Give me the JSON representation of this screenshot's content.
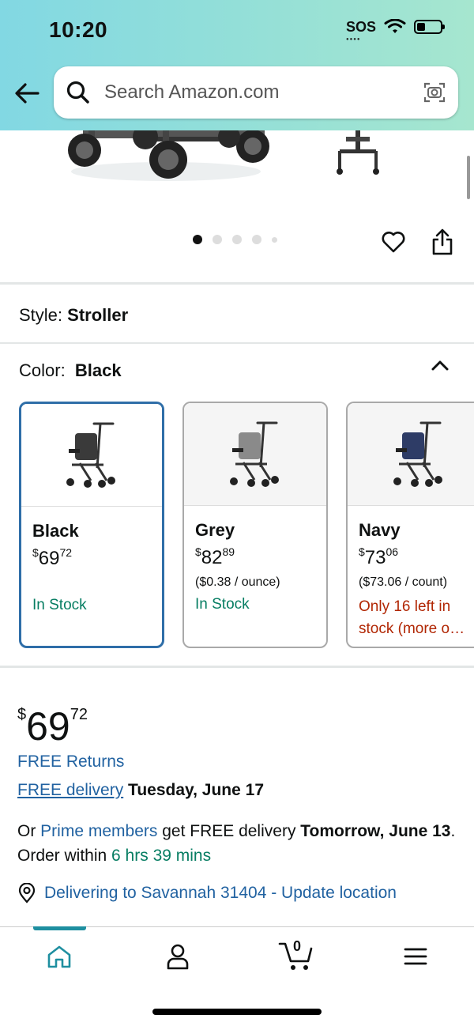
{
  "status_bar": {
    "time": "10:20",
    "sos": "SOS"
  },
  "search": {
    "placeholder": "Search Amazon.com"
  },
  "style": {
    "label": "Style:",
    "value": "Stroller"
  },
  "color": {
    "label": "Color:",
    "value": "Black"
  },
  "swatches": [
    {
      "name": "Black",
      "currency": "$",
      "whole": "69",
      "fraction": "72",
      "unit": "",
      "stock": "In Stock",
      "stock_status": "in-stock",
      "frame_color": "#3a3a3a",
      "selected": true
    },
    {
      "name": "Grey",
      "currency": "$",
      "whole": "82",
      "fraction": "89",
      "unit": "($0.38 / ounce)",
      "stock": "In Stock",
      "stock_status": "in-stock",
      "frame_color": "#8a8a8a",
      "selected": false
    },
    {
      "name": "Navy",
      "currency": "$",
      "whole": "73",
      "fraction": "06",
      "unit": "($73.06 / count)",
      "stock": "Only 16 left in stock (more o…",
      "stock_status": "low-stock",
      "frame_color": "#2e3c66",
      "selected": false
    }
  ],
  "price": {
    "currency": "$",
    "whole": "69",
    "fraction": "72"
  },
  "returns": {
    "text": "FREE Returns"
  },
  "delivery": {
    "link": "FREE delivery",
    "date": "Tuesday, June 17"
  },
  "prime": {
    "prefix": "Or ",
    "link": "Prime members",
    "middle": " get FREE delivery ",
    "date": "Tomorrow, June 13",
    "mid2": ". Order within ",
    "countdown": "6 hrs 39 mins"
  },
  "location": {
    "text": "Delivering to Savannah 31404 - Update location"
  },
  "cart": {
    "count": "0"
  },
  "colors": {
    "link": "#2162a1",
    "green": "#067d62",
    "red": "#b12704",
    "selected_border": "#2f6ea8"
  },
  "icons": [
    "back-arrow-icon",
    "search-icon",
    "camera-icon",
    "heart-icon",
    "share-icon",
    "chevron-up-icon",
    "location-pin-icon",
    "home-icon",
    "account-icon",
    "cart-icon",
    "menu-icon"
  ]
}
